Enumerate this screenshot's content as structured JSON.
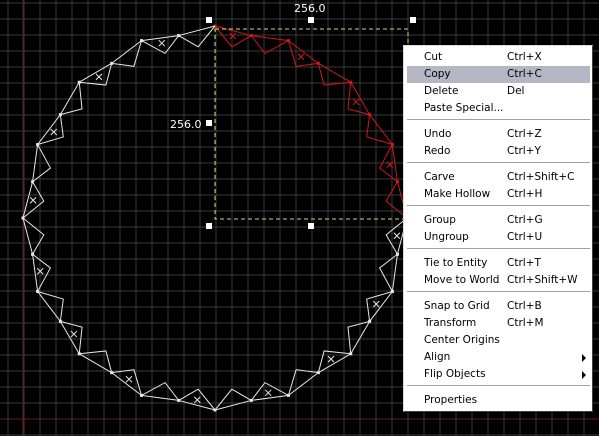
{
  "viewport": {
    "width_label": "256.0",
    "height_label": "256.0"
  },
  "context_menu": {
    "items": [
      {
        "label": "Cut",
        "shortcut": "Ctrl+X"
      },
      {
        "label": "Copy",
        "shortcut": "Ctrl+C",
        "highlighted": true
      },
      {
        "label": "Delete",
        "shortcut": "Del"
      },
      {
        "label": "Paste Special...",
        "shortcut": ""
      },
      {
        "label": "Undo",
        "shortcut": "Ctrl+Z"
      },
      {
        "label": "Redo",
        "shortcut": "Ctrl+Y"
      },
      {
        "label": "Carve",
        "shortcut": "Ctrl+Shift+C"
      },
      {
        "label": "Make Hollow",
        "shortcut": "Ctrl+H"
      },
      {
        "label": "Group",
        "shortcut": "Ctrl+G"
      },
      {
        "label": "Ungroup",
        "shortcut": "Ctrl+U"
      },
      {
        "label": "Tie to Entity",
        "shortcut": "Ctrl+T"
      },
      {
        "label": "Move to World",
        "shortcut": "Ctrl+Shift+W"
      },
      {
        "label": "Snap to Grid",
        "shortcut": "Ctrl+B"
      },
      {
        "label": "Transform",
        "shortcut": "Ctrl+M"
      },
      {
        "label": "Center Origins",
        "shortcut": ""
      },
      {
        "label": "Align",
        "shortcut": "",
        "submenu": true
      },
      {
        "label": "Flip Objects",
        "shortcut": "",
        "submenu": true
      },
      {
        "label": "Properties",
        "shortcut": ""
      }
    ]
  },
  "colors": {
    "background": "#000000",
    "grid": "#3a3a3a",
    "grid_major": "#5a5a5a",
    "axis": "#6a1818",
    "selected_brush": "#d01818",
    "unselected_brush": "#e8e8e8",
    "selection_box": "#d8d880",
    "menu_highlight": "#b6b6c4"
  }
}
